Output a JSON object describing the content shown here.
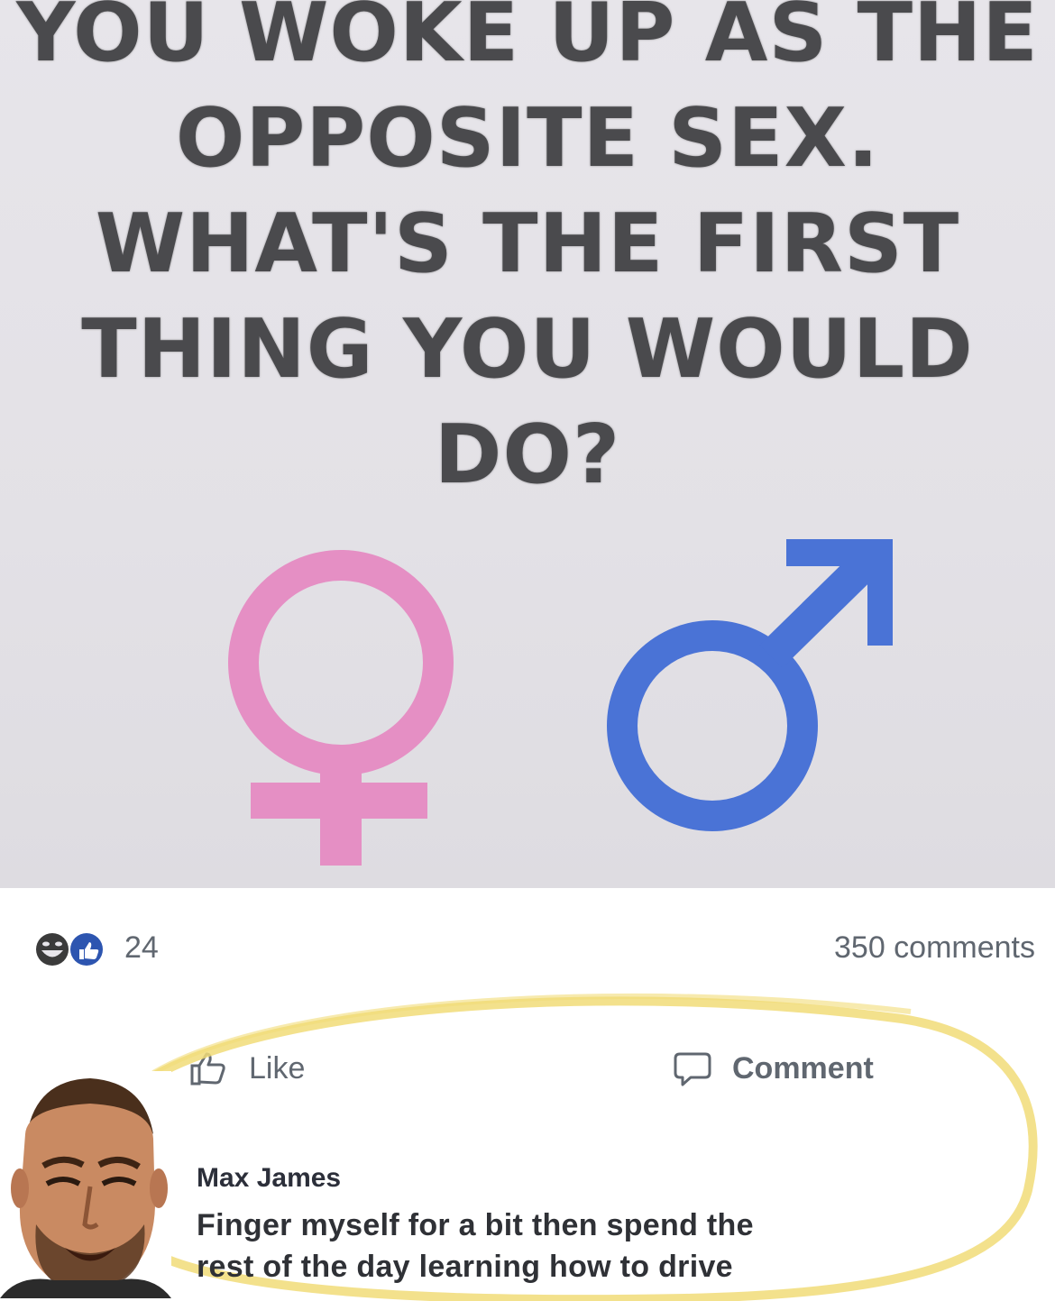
{
  "post": {
    "headline_lines": [
      "YOU WOKE UP AS THE",
      "OPPOSITE SEX.",
      "WHAT'S THE FIRST",
      "THING YOU WOULD",
      "DO?"
    ],
    "female_symbol": {
      "icon": "female-symbol-icon",
      "color": "#e58fc4"
    },
    "male_symbol": {
      "icon": "male-symbol-icon",
      "color": "#4a73d6"
    },
    "background_color": "#e5e3e8"
  },
  "stats": {
    "reaction_icons": [
      "haha-reaction-icon",
      "like-reaction-icon"
    ],
    "reaction_count": "24",
    "comments_count": "350 comments"
  },
  "actions": {
    "like_label": "Like",
    "comment_label": "Comment"
  },
  "comment": {
    "author": "Max James",
    "text_lines": [
      "Finger myself for a bit then spend the",
      "rest of the day learning how to drive"
    ]
  },
  "highlight_color": "#f1dc78"
}
